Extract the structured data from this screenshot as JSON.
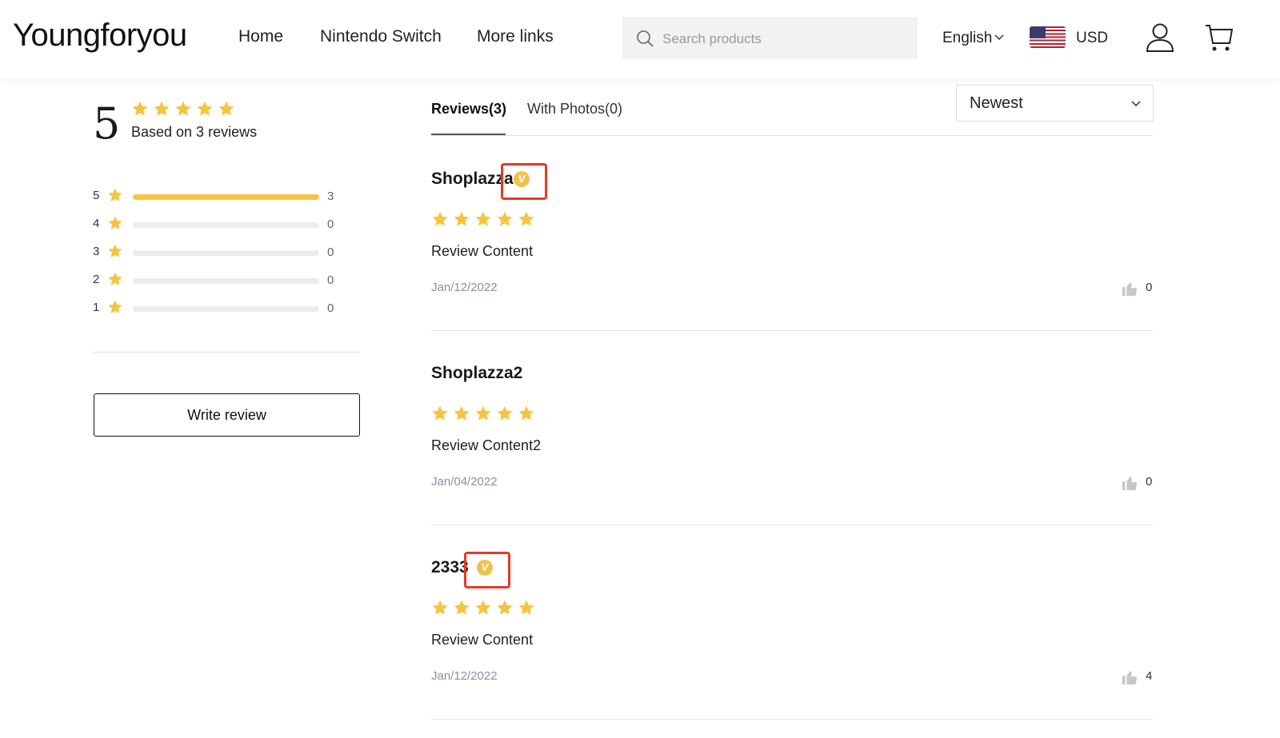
{
  "header": {
    "logo": "Youngforyou",
    "nav": [
      "Home",
      "Nintendo Switch",
      "More links"
    ],
    "search_placeholder": "Search products",
    "language": "English",
    "currency": "USD"
  },
  "summary": {
    "score": "5",
    "stars": 5,
    "based_on": "Based on 3 reviews",
    "distribution": [
      {
        "stars": "5",
        "count": "3",
        "fraction": 1.0
      },
      {
        "stars": "4",
        "count": "0",
        "fraction": 0
      },
      {
        "stars": "3",
        "count": "0",
        "fraction": 0
      },
      {
        "stars": "2",
        "count": "0",
        "fraction": 0
      },
      {
        "stars": "1",
        "count": "0",
        "fraction": 0
      }
    ],
    "write_review": "Write review"
  },
  "tabs": {
    "reviews": "Reviews(3)",
    "photos": "With Photos(0)"
  },
  "sort": {
    "selected": "Newest"
  },
  "reviews": [
    {
      "name": "Shoplazza",
      "verified": true,
      "verified_mark": "V",
      "stars": 5,
      "content": "Review Content",
      "date": "Jan/12/2022",
      "likes": "0"
    },
    {
      "name": "Shoplazza2",
      "verified": false,
      "stars": 5,
      "content": "Review Content2",
      "date": "Jan/04/2022",
      "likes": "0"
    },
    {
      "name": "2333",
      "verified": true,
      "verified_mark": "V",
      "stars": 5,
      "content": "Review Content",
      "date": "Jan/12/2022",
      "likes": "4"
    }
  ],
  "colors": {
    "star": "#f5c542",
    "highlight": "#e53a24",
    "badge": "#f0c24d"
  }
}
